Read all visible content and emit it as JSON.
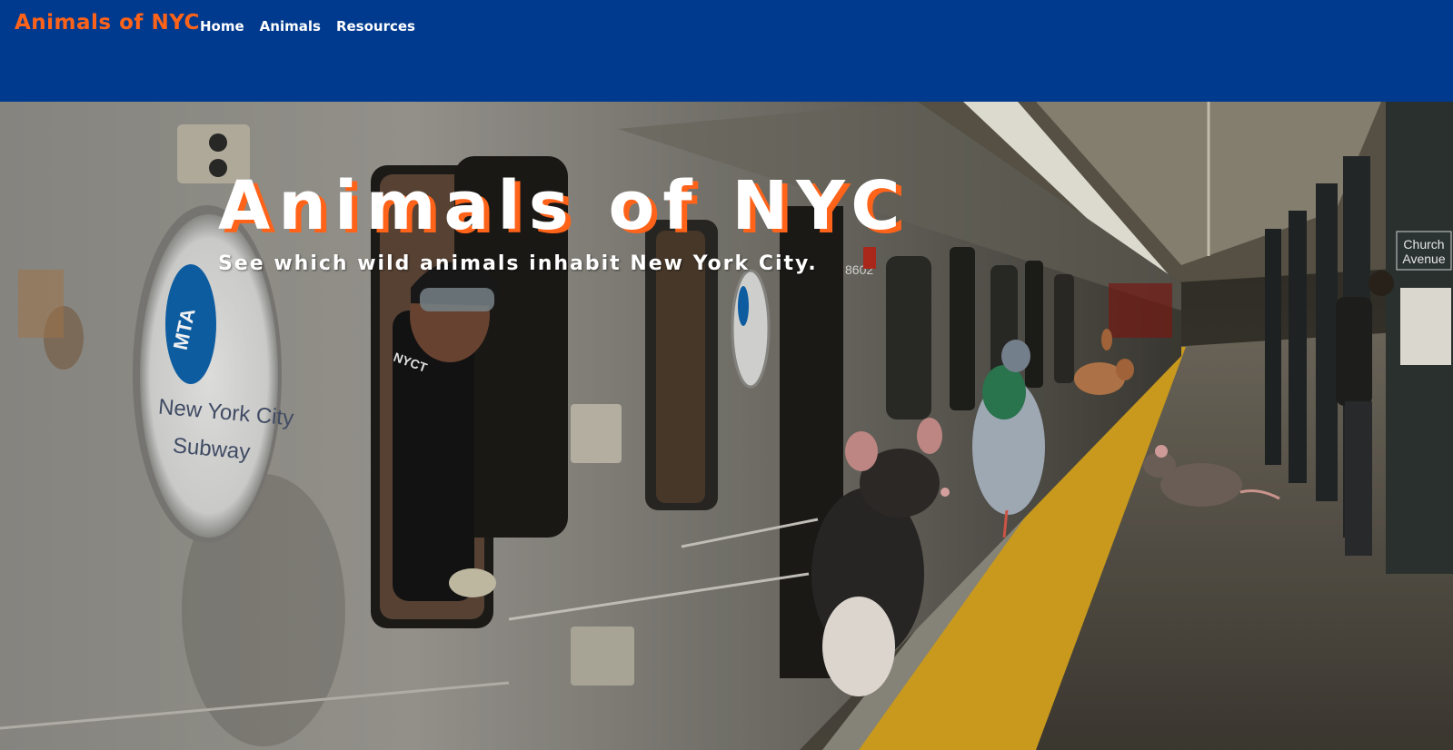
{
  "header": {
    "brand": "Animals of NYC",
    "nav": [
      {
        "label": "Home"
      },
      {
        "label": "Animals"
      },
      {
        "label": "Resources"
      }
    ]
  },
  "hero": {
    "title": "Animals of NYC",
    "subtitle": "See which wild animals inhabit New York City.",
    "image": {
      "mta_logo_text": "MTA",
      "subway_sign_line1": "New York City",
      "subway_sign_line2": "Subway",
      "station_sign_line1": "Church",
      "station_sign_line2": "Avenue",
      "car_number": "8602",
      "jacket_text": "NYCT"
    }
  },
  "colors": {
    "header_bg": "#003a8e",
    "brand": "#ff6319",
    "nav_text": "#ffffff",
    "title_text": "#ffffff",
    "title_shadow": "#ff6319",
    "mta_blue": "#0f61a9",
    "platform_yellow": "#d9a81e"
  }
}
